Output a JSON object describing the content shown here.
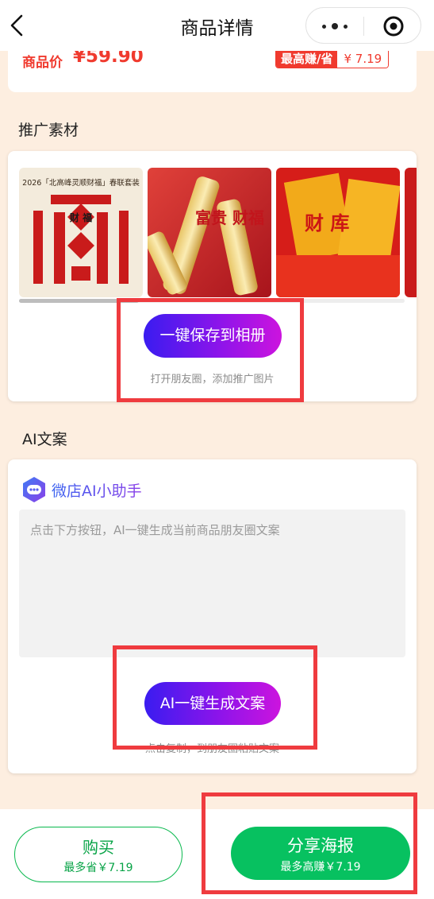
{
  "nav": {
    "title": "商品详情",
    "back_icon": "chevron-left-icon",
    "more_icon": "more-dots-icon",
    "close_icon": "target-close-icon"
  },
  "price": {
    "label": "商品价",
    "value": "¥59.90",
    "max_earn_label": "最高赚/省",
    "max_earn_value": "¥ 7.19"
  },
  "materials": {
    "title": "推广素材",
    "images": [
      {
        "caption": "2026「北高峰灵顺财福」春联套装",
        "text": "财 福"
      },
      {
        "text": "富贵 财福"
      },
      {
        "text": "财 库"
      }
    ],
    "save_button": "一键保存到相册",
    "hint": "打开朋友圈，添加推广图片"
  },
  "ai": {
    "title": "AI文案",
    "assistant_name": "微店AI小助手",
    "placeholder": "点击下方按钮，AI一键生成当前商品朋友圈文案",
    "generate_button": "AI一键生成文案",
    "hint": "点击复制，到朋友圈粘贴文案"
  },
  "bottom": {
    "buy_label": "购买",
    "buy_sub": "最多省￥7.19",
    "share_label": "分享海报",
    "share_sub": "最多高赚￥7.19"
  },
  "colors": {
    "accent_red": "#f03a2e",
    "wechat_green": "#07c160",
    "gradient_start": "#3a1cf0",
    "gradient_end": "#cc14de",
    "page_bg": "#fdeee0",
    "annotation_red": "#ef3b3f"
  }
}
